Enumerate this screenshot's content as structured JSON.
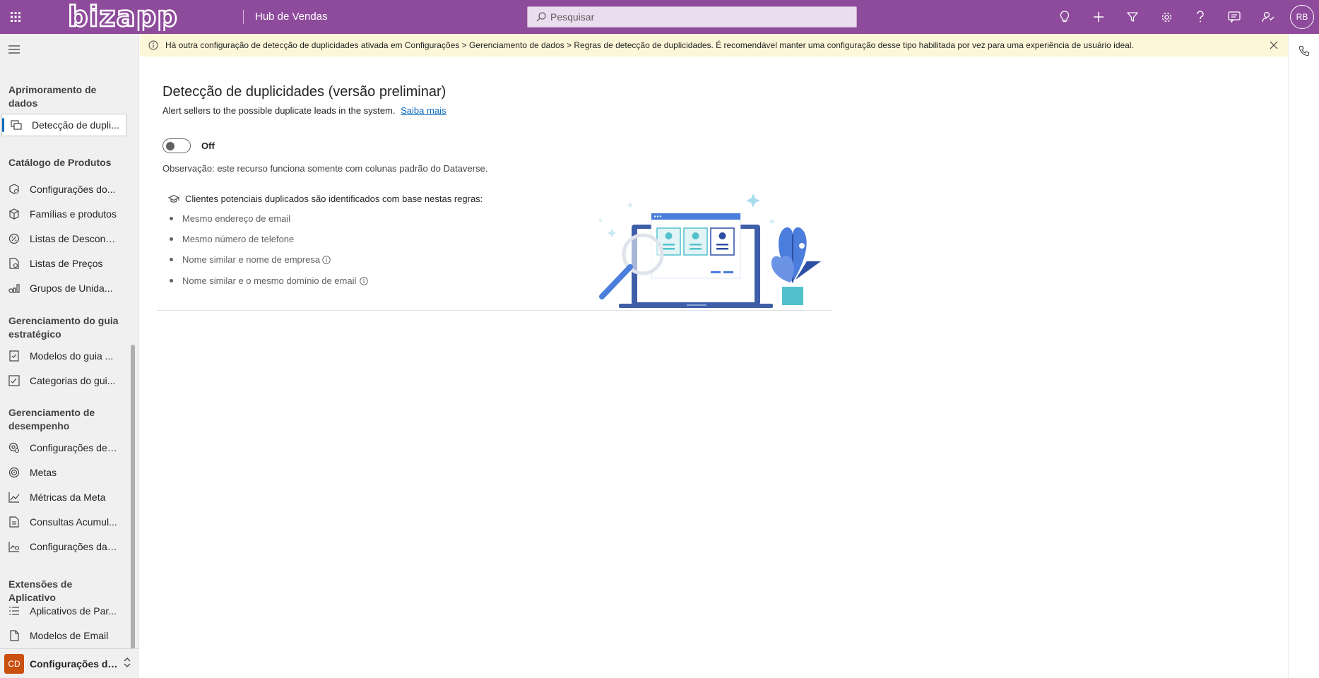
{
  "header": {
    "logo_text": "bizapp",
    "app_name": "Hub de Vendas",
    "search_placeholder": "Pesquisar",
    "avatar_initials": "RB",
    "icons": [
      "lightbulb-icon",
      "plus-icon",
      "filter-icon",
      "gear-icon",
      "help-icon",
      "chat-icon",
      "assist-icon"
    ]
  },
  "sidebar": {
    "groups": [
      {
        "title": "Aprimoramento de dados",
        "items": [
          {
            "label": "Detecção de dupli...",
            "icon": "duplicate-detection-icon",
            "active": true
          }
        ]
      },
      {
        "title": "Catálogo de Produtos",
        "items": [
          {
            "label": "Configurações do...",
            "icon": "settings-catalog-icon"
          },
          {
            "label": "Famílias e produtos",
            "icon": "box-icon"
          },
          {
            "label": "Listas de Descontos",
            "icon": "discount-icon"
          },
          {
            "label": "Listas de Preços",
            "icon": "price-list-icon"
          },
          {
            "label": "Grupos de Unida...",
            "icon": "unit-group-icon"
          }
        ]
      },
      {
        "title": "Gerenciamento do guia estratégico",
        "items": [
          {
            "label": "Modelos do guia ...",
            "icon": "playbook-template-icon"
          },
          {
            "label": "Categorias do gui...",
            "icon": "playbook-category-icon"
          }
        ]
      },
      {
        "title": "Gerenciamento de desempenho",
        "items": [
          {
            "label": "Configurações de ...",
            "icon": "performance-settings-icon"
          },
          {
            "label": "Metas",
            "icon": "target-icon"
          },
          {
            "label": "Métricas da Meta",
            "icon": "chart-line-icon"
          },
          {
            "label": "Consultas Acumul...",
            "icon": "rollup-query-icon"
          },
          {
            "label": "Configurações da ...",
            "icon": "forecast-settings-icon"
          }
        ]
      },
      {
        "title": "Extensões de Aplicativo",
        "items": [
          {
            "label": "Aplicativos de Par...",
            "icon": "list-icon"
          },
          {
            "label": "Modelos de Email",
            "icon": "document-icon"
          }
        ]
      }
    ],
    "area_badge": "CD",
    "area_label": "Configurações do..."
  },
  "banner": {
    "text": "Há outra configuração de detecção de duplicidades ativada em Configurações > Gerenciamento de dados > Regras de detecção de duplicidades. É recomendável manter uma configuração desse tipo habilitada por vez para uma experiência de usuário ideal."
  },
  "main": {
    "title": "Detecção de duplicidades (versão preliminar)",
    "subtitle": "Alert sellers to the possible duplicate leads in the system.",
    "learn_more": "Saiba mais",
    "toggle_state": "Off",
    "note": "Observação: este recurso funciona somente com colunas padrão do Dataverse.",
    "rules_heading": "Clientes potenciais duplicados são identificados com base nestas regras:",
    "rules": [
      "Mesmo endereço de email",
      "Mesmo número de telefone",
      "Nome similar e nome de empresa",
      "Nome similar e o mesmo domínio de email"
    ]
  },
  "colors": {
    "header_bg": "#8e4b9c",
    "banner_bg": "#fdf6d9",
    "accent": "#0f6cbd",
    "area_badge": "#ca5010"
  }
}
